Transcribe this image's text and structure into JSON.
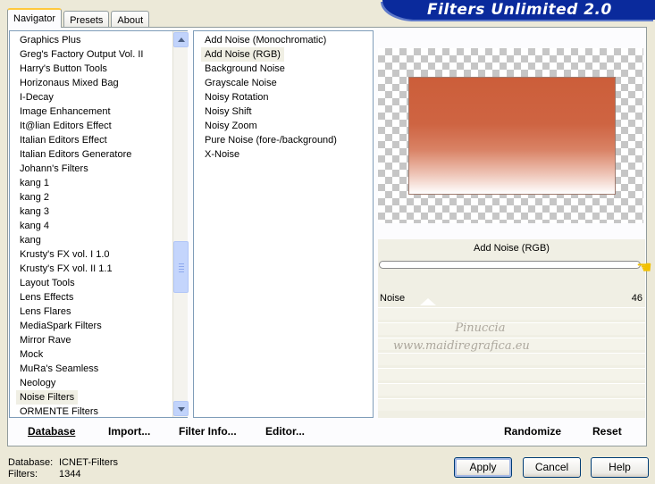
{
  "window": {
    "title": "Filters Unlimited 2.0"
  },
  "tabs": [
    {
      "label": "Navigator",
      "active": true
    },
    {
      "label": "Presets",
      "active": false
    },
    {
      "label": "About",
      "active": false
    }
  ],
  "categories": {
    "items": [
      "Graphics Plus",
      "Greg's Factory Output Vol. II",
      "Harry's Button Tools",
      "Horizonaus Mixed Bag",
      "I-Decay",
      "Image Enhancement",
      "It@lian Editors Effect",
      "Italian Editors Effect",
      "Italian Editors Generatore",
      "Johann's Filters",
      "kang 1",
      "kang 2",
      "kang 3",
      "kang 4",
      "kang",
      "Krusty's FX vol. I 1.0",
      "Krusty's FX vol. II 1.1",
      "Layout Tools",
      "Lens Effects",
      "Lens Flares",
      "MediaSpark Filters",
      "Mirror Rave",
      "Mock",
      "MuRa's Seamless",
      "Neology",
      "Noise Filters",
      "ORMENTE Filters"
    ],
    "selected": "Noise Filters"
  },
  "filters": {
    "items": [
      "Add Noise (Monochromatic)",
      "Add Noise (RGB)",
      "Background Noise",
      "Grayscale Noise",
      "Noisy Rotation",
      "Noisy Shift",
      "Noisy Zoom",
      "Pure Noise (fore-/background)",
      "X-Noise"
    ],
    "selected": "Add Noise (RGB)"
  },
  "controls": {
    "filter_title": "Add Noise (RGB)",
    "params": [
      {
        "name": "Noise",
        "value": "46"
      }
    ],
    "watermark_line1": "Pinuccia",
    "watermark_line2": "www.maidiregrafica.eu"
  },
  "bottom_links": {
    "database": "Database",
    "import": "Import...",
    "filter_info": "Filter Info...",
    "editor": "Editor...",
    "randomize": "Randomize",
    "reset": "Reset"
  },
  "status": {
    "database_label": "Database:",
    "database_value": "ICNET-Filters",
    "filters_label": "Filters:",
    "filters_value": "1344"
  },
  "buttons": {
    "apply": "Apply",
    "cancel": "Cancel",
    "help": "Help"
  },
  "colors": {
    "title_bar": "#0A2A9C",
    "tab_highlight": "#FFC83C",
    "preview_main": "#CC5E3A"
  }
}
